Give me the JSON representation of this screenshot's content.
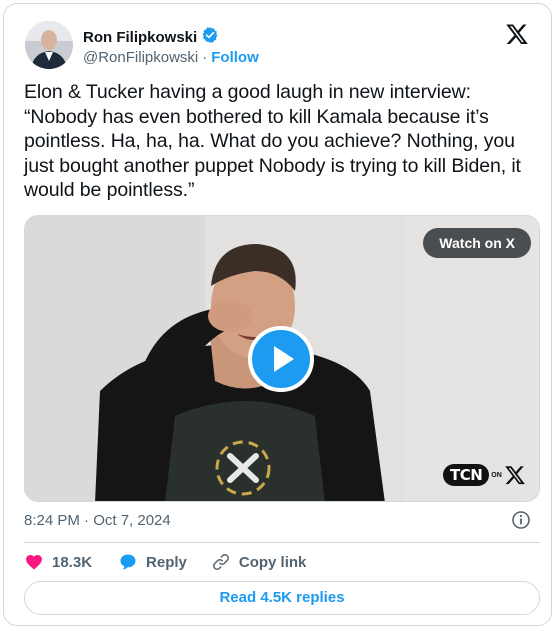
{
  "author": {
    "display_name": "Ron Filipkowski",
    "handle": "@RonFilipkowski",
    "separator": "·",
    "follow_label": "Follow",
    "verified": true
  },
  "tweet": {
    "text": "Elon & Tucker having a good laugh in new interview: “Nobody has even bothered to kill Kamala because it’s pointless. Ha, ha, ha. What do you achieve? Nothing, you just bought another puppet Nobody is trying to kill Biden, it would be pointless.”",
    "timestamp": "8:24 PM · Oct 7, 2024"
  },
  "media": {
    "watch_label": "Watch on X",
    "watermark_text": "TCN",
    "watermark_on": "ON"
  },
  "actions": {
    "like_count": "18.3K",
    "reply_label": "Reply",
    "copy_link_label": "Copy link",
    "read_replies_label": "Read 4.5K replies"
  },
  "colors": {
    "accent": "#1d9bf0",
    "like": "#f91880",
    "text": "#0f1419",
    "secondary": "#536471",
    "border": "#cfd9de"
  },
  "icons": [
    "verified-badge-icon",
    "x-logo-icon",
    "play-icon",
    "info-icon",
    "heart-icon",
    "reply-bubble-icon",
    "link-icon"
  ]
}
